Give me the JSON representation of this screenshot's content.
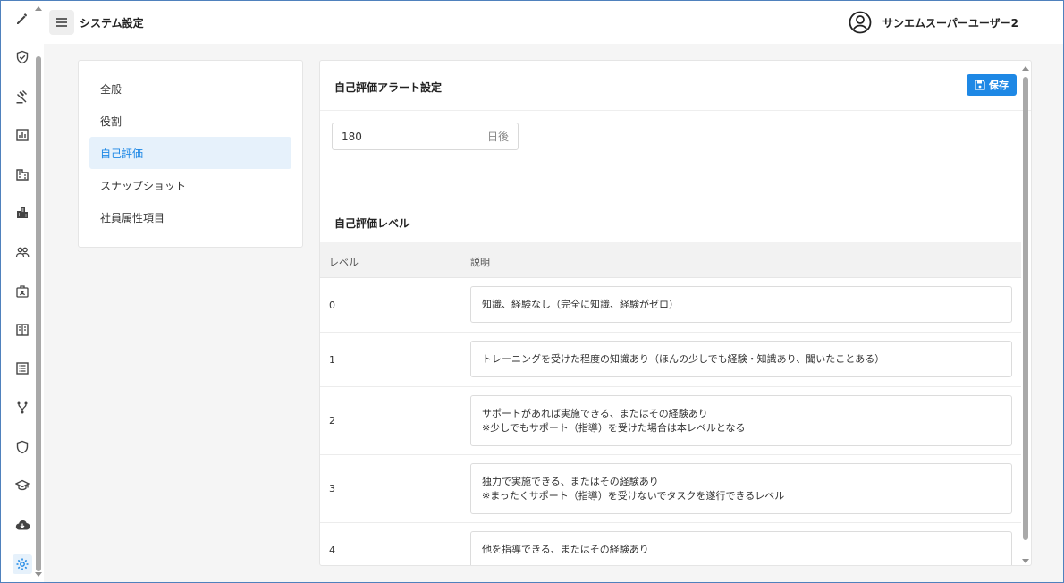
{
  "header": {
    "title": "システム設定",
    "user_name": "サンエムスーパーユーザー2"
  },
  "rail_icons": [
    "pencil-icon",
    "shield-check-icon",
    "gavel-icon",
    "chart-icon",
    "building-icon",
    "buildings-icon",
    "users-icon",
    "badge-icon",
    "book-icon",
    "list-icon",
    "branch-icon",
    "shield-icon",
    "graduation-icon",
    "cloud-download-icon",
    "gear-icon"
  ],
  "settings_menu": {
    "items": [
      {
        "label": "全般"
      },
      {
        "label": "役割"
      },
      {
        "label": "自己評価"
      },
      {
        "label": "スナップショット"
      },
      {
        "label": "社員属性項目"
      }
    ],
    "active_index": 2
  },
  "alert_settings": {
    "title": "自己評価アラート設定",
    "save_label": "保存",
    "days_value": "180",
    "days_suffix": "日後"
  },
  "levels": {
    "title": "自己評価レベル",
    "col_level": "レベル",
    "col_desc": "説明",
    "rows": [
      {
        "level": "0",
        "line1": "知識、経験なし（完全に知識、経験がゼロ）",
        "line2": ""
      },
      {
        "level": "1",
        "line1": "トレーニングを受けた程度の知識あり（ほんの少しでも経験・知識あり、聞いたことある）",
        "line2": ""
      },
      {
        "level": "2",
        "line1": "サポートがあれば実施できる、またはその経験あり",
        "line2": "※少しでもサポート（指導）を受けた場合は本レベルとなる"
      },
      {
        "level": "3",
        "line1": "独力で実施できる、またはその経験あり",
        "line2": "※まったくサポート（指導）を受けないでタスクを遂行できるレベル"
      },
      {
        "level": "4",
        "line1": "他を指導できる、またはその経験あり",
        "line2": ""
      }
    ]
  },
  "colors": {
    "accent": "#1e88e5",
    "active_bg": "#e6f1fb",
    "frame_border": "#4f81bd"
  }
}
